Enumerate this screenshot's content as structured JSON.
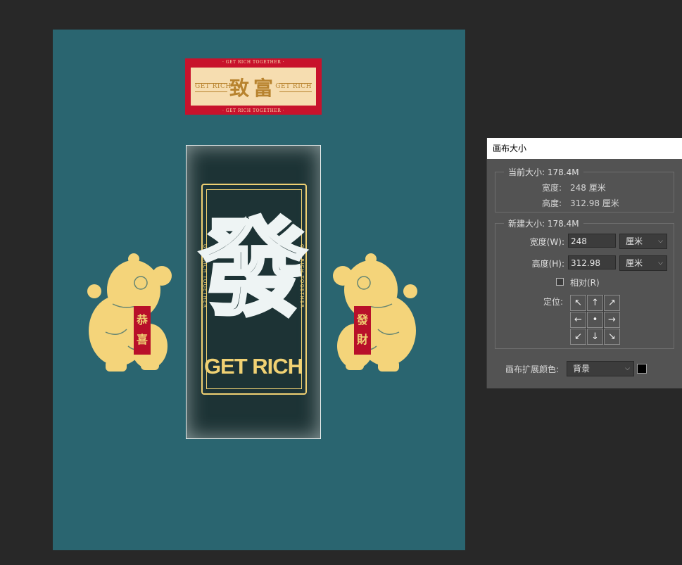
{
  "artwork": {
    "banner": {
      "top_strip": "· GET RICH TOGETHER ·",
      "bottom_strip": "· GET RICH TOGETHER ·",
      "left_text": "GET RICH",
      "right_text": "GET RICH",
      "title": "致富"
    },
    "panel": {
      "big_character": "發",
      "side_text_left": "GET RICH TOGETHER",
      "side_text_right": "GET RICH TOGETHER",
      "caption": "GET RICH"
    },
    "lion_left_scroll": [
      "恭",
      "喜"
    ],
    "lion_right_scroll": [
      "發",
      "財"
    ],
    "colors": {
      "canvas": "#2a6570",
      "gold": "#f0d173",
      "red": "#c8122c",
      "panel": "#1d3335"
    }
  },
  "dialog": {
    "title": "画布大小",
    "current": {
      "label": "当前大小: 178.4M",
      "width_label": "宽度:",
      "width_value": "248 厘米",
      "height_label": "高度:",
      "height_value": "312.98 厘米"
    },
    "new": {
      "label": "新建大小: 178.4M",
      "width_label": "宽度(W):",
      "width_value": "248",
      "width_unit": "厘米",
      "height_label": "高度(H):",
      "height_value": "312.98",
      "height_unit": "厘米",
      "relative_label": "相对(R)",
      "relative_checked": false,
      "anchor_label": "定位:",
      "anchor_arrows": [
        "↖",
        "↑",
        "↗",
        "←",
        "•",
        "→",
        "↙",
        "↓",
        "↘"
      ]
    },
    "extension_color_label": "画布扩展颜色:",
    "extension_color_value": "背景",
    "extension_swatch": "#000000"
  }
}
